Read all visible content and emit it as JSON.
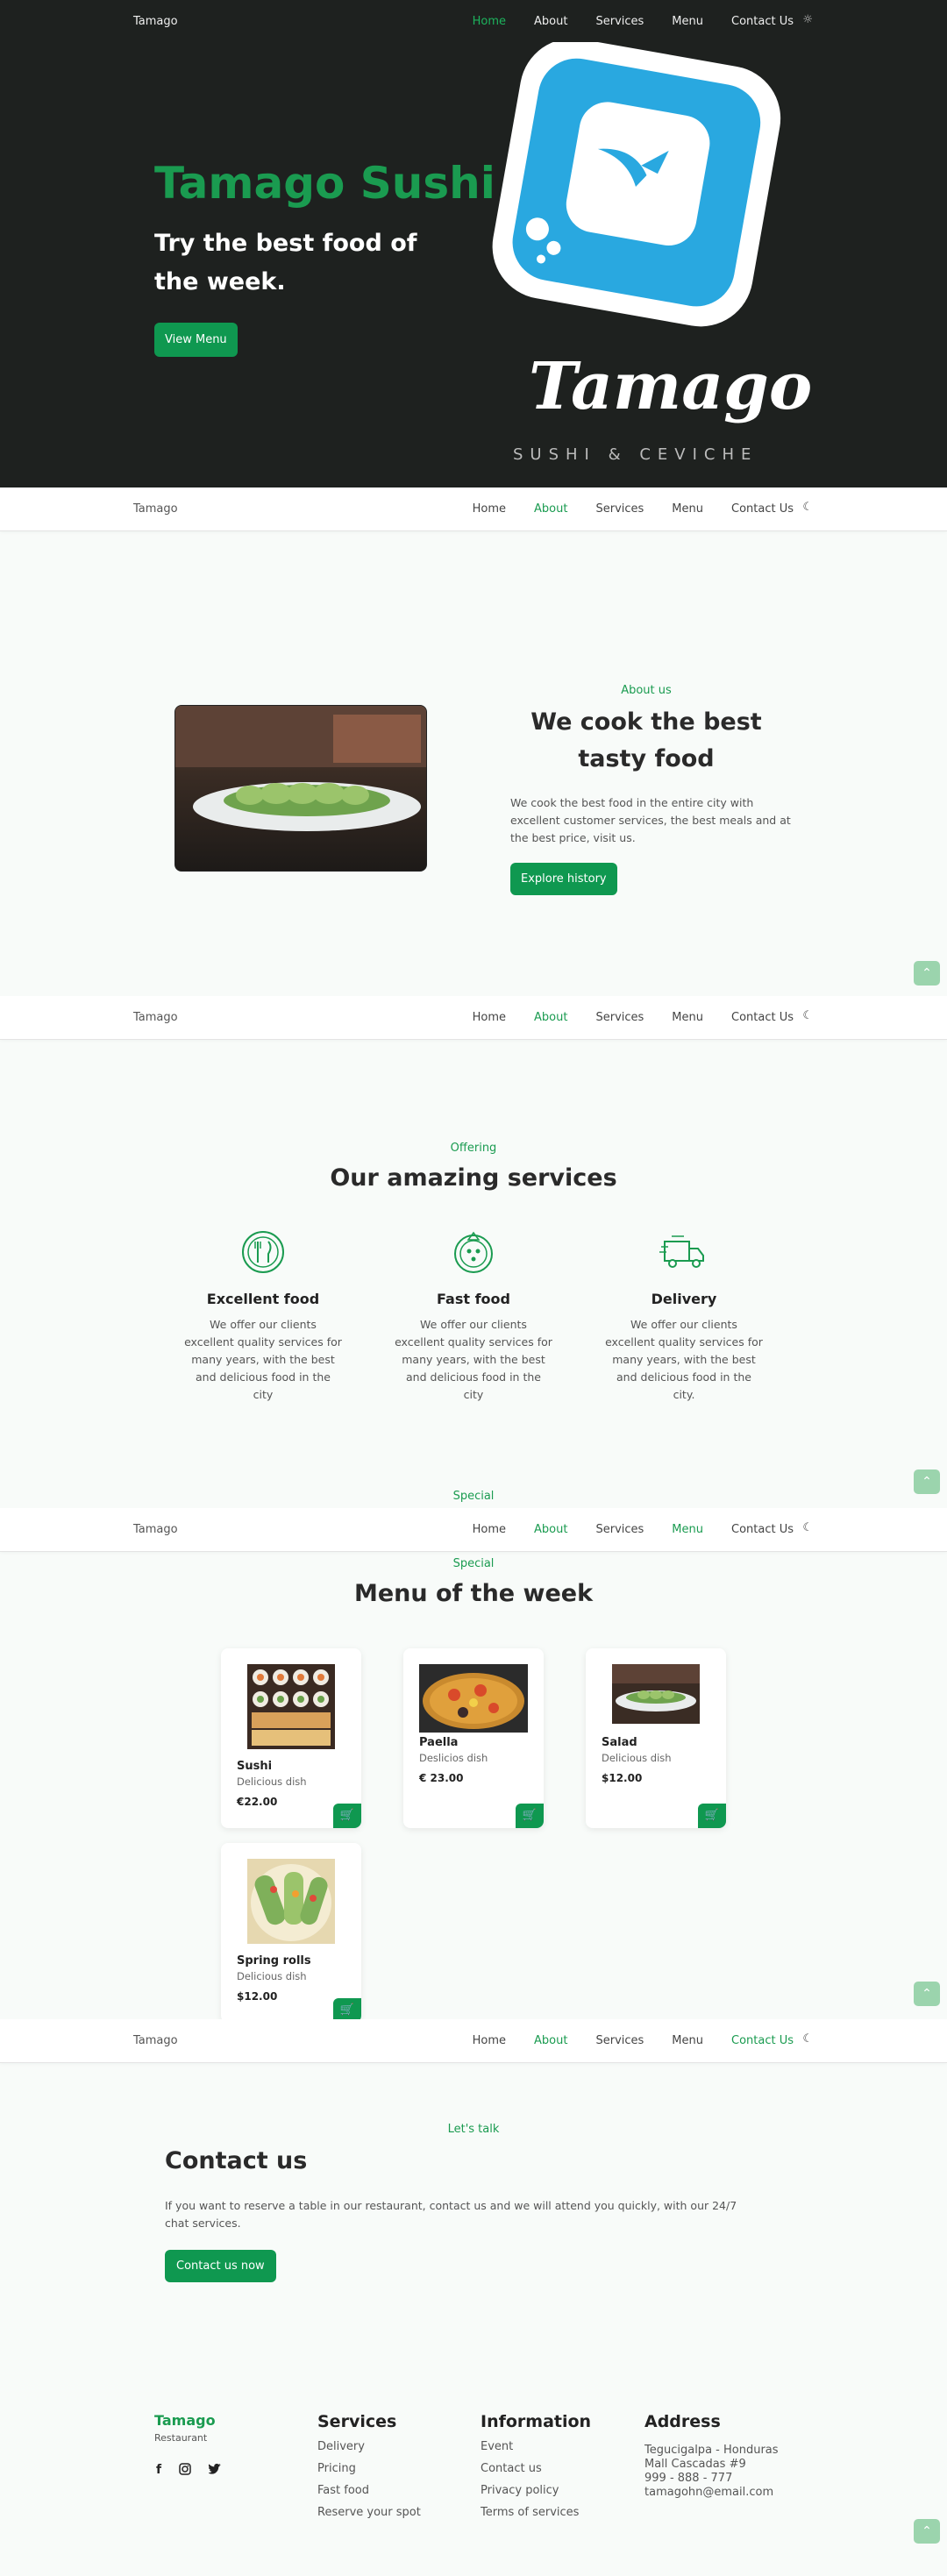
{
  "brand": "Tamago",
  "nav": {
    "home": "Home",
    "about": "About",
    "services": "Services",
    "menu": "Menu",
    "contact": "Contact Us",
    "sun_icon": "☼",
    "moon_icon": "☾"
  },
  "hero": {
    "title": "Tamago Sushi",
    "subtitle_line1": "Try the best food of",
    "subtitle_line2": "the week.",
    "button": "View Menu",
    "logo_word": "Tamago",
    "logo_tagline": "SUSHI & CEVICHE"
  },
  "about": {
    "tag": "About us",
    "title_line1": "We cook the best",
    "title_line2": "tasty food",
    "body": "We cook the best food in the entire city with excellent customer services, the best meals and at the best price, visit us.",
    "button": "Explore history"
  },
  "services": {
    "tag": "Offering",
    "title": "Our amazing services",
    "items": [
      {
        "title": "Excellent food",
        "text": "We offer our clients excellent quality services for many years, with the best and delicious food in the city",
        "icon": "cutlery-icon"
      },
      {
        "title": "Fast food",
        "text": "We offer our clients excellent quality services for many years, with the best and delicious food in the city",
        "icon": "pizza-icon"
      },
      {
        "title": "Delivery",
        "text": "We offer our clients excellent quality services for many years, with the best and delicious food in the city.",
        "icon": "truck-icon"
      }
    ],
    "overflow_tag": "Special"
  },
  "menu": {
    "tag": "Special",
    "title": "Menu of the week",
    "items": [
      {
        "name": "Sushi",
        "desc": "Delicious dish",
        "price": "€22.00"
      },
      {
        "name": "Paella",
        "desc": "Deslicios dish",
        "price": "€ 23.00"
      },
      {
        "name": "Salad",
        "desc": "Delicious dish",
        "price": "$12.00"
      },
      {
        "name": "Spring rolls",
        "desc": "Delicious dish",
        "price": "$12.00"
      }
    ]
  },
  "contact": {
    "tag": "Let's talk",
    "title": "Contact us",
    "body": "If you want to reserve a table in our restaurant, contact us and we will attend you quickly, with our 24/7 chat services.",
    "button": "Contact us now"
  },
  "footer": {
    "brand": "Tamago",
    "sub": "Restaurant",
    "services_title": "Services",
    "services": [
      "Delivery",
      "Pricing",
      "Fast food",
      "Reserve your spot"
    ],
    "info_title": "Information",
    "info": [
      "Event",
      "Contact us",
      "Privacy policy",
      "Terms of services"
    ],
    "address_title": "Address",
    "address": [
      "Tegucigalpa - Honduras",
      "Mall Cascadas #9",
      "999 - 888 - 777",
      "tamagohn@email.com"
    ]
  },
  "colors": {
    "accent": "#0f9850",
    "hero_bg": "#1e211f",
    "logo_blue": "#29a8e0"
  }
}
